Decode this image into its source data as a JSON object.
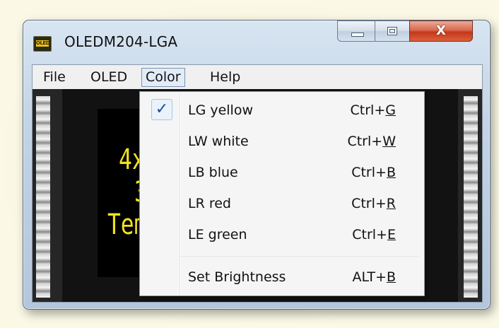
{
  "window": {
    "title": "OLEDM204-LGA",
    "icon_text": "OLED"
  },
  "controls": {
    "close_glyph": "X"
  },
  "menubar": {
    "items": [
      "File",
      "OLED",
      "Color",
      "Help"
    ],
    "active": "Color"
  },
  "display": {
    "lines": [
      "4x2",
      "3",
      "Temp"
    ],
    "text_color": "#f3e21c"
  },
  "color_menu": {
    "items": [
      {
        "label": "LG yellow",
        "shortcut_prefix": "Ctrl+",
        "shortcut_key": "G",
        "checked": true
      },
      {
        "label": "LW white",
        "shortcut_prefix": "Ctrl+",
        "shortcut_key": "W",
        "checked": false
      },
      {
        "label": "LB blue",
        "shortcut_prefix": "Ctrl+",
        "shortcut_key": "B",
        "checked": false
      },
      {
        "label": "LR red",
        "shortcut_prefix": "Ctrl+",
        "shortcut_key": "R",
        "checked": false
      },
      {
        "label": "LE green",
        "shortcut_prefix": "Ctrl+",
        "shortcut_key": "E",
        "checked": false
      }
    ],
    "brightness": {
      "label": "Set Brightness",
      "shortcut_prefix": "ALT+",
      "shortcut_key": "B"
    },
    "check_glyph": "✓"
  },
  "colors": {
    "accent": "#1c4fa0",
    "close_red": "#c4381a",
    "oled_yellow": "#f3e21c"
  }
}
